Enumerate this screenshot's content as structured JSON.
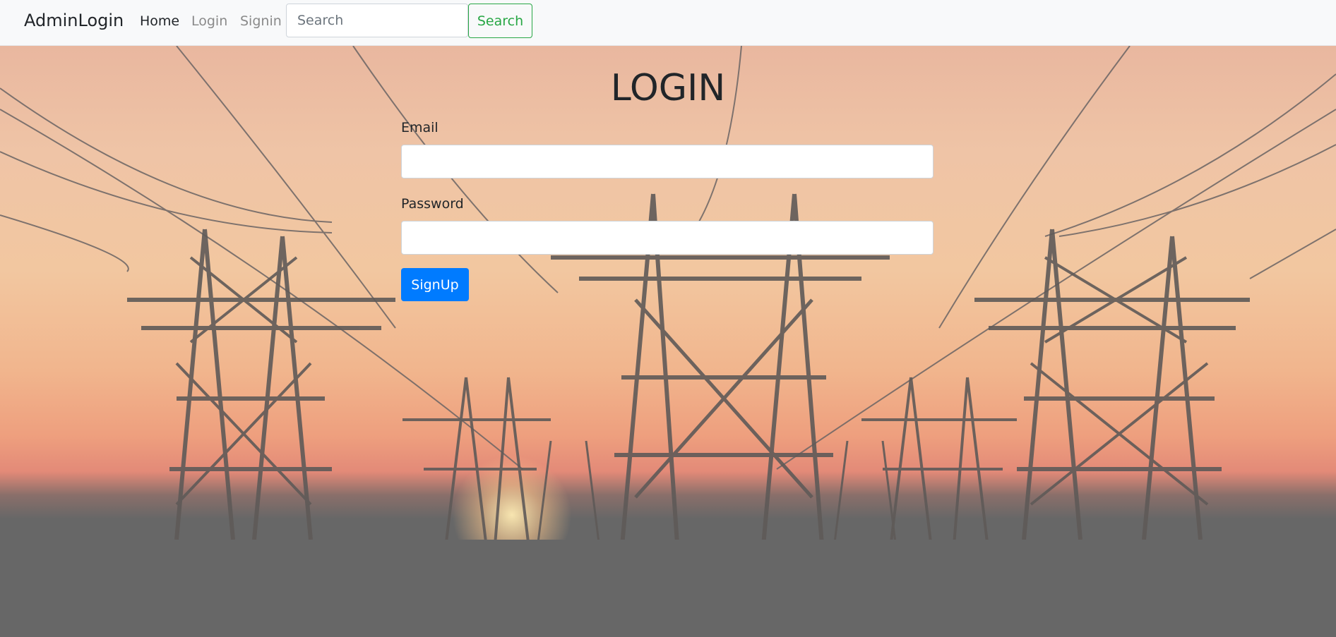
{
  "navbar": {
    "brand": "AdminLogin",
    "links": [
      {
        "label": "Home",
        "active": true
      },
      {
        "label": "Login",
        "active": false
      },
      {
        "label": "Signin",
        "active": false
      }
    ],
    "search": {
      "placeholder": "Search",
      "value": "",
      "button_label": "Search"
    }
  },
  "form": {
    "title": "LOGIN",
    "email_label": "Email",
    "email_value": "",
    "password_label": "Password",
    "password_value": "",
    "submit_label": "SignUp"
  },
  "colors": {
    "navbar_bg": "#f8f9fa",
    "search_button": "#28a745",
    "primary_button": "#007bff"
  },
  "background": {
    "image": "power-transmission-towers-at-sunset"
  }
}
